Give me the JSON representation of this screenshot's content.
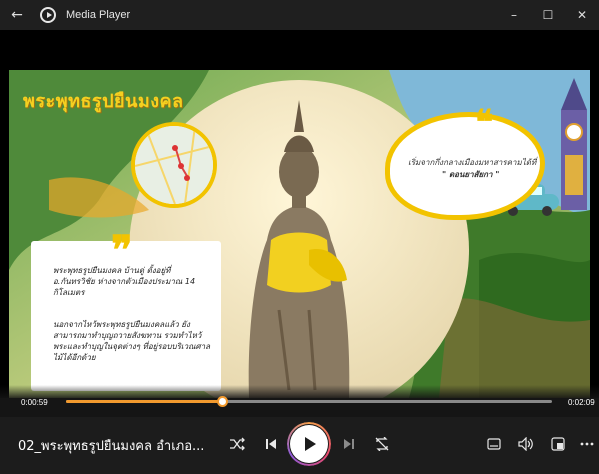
{
  "window": {
    "title": "Media Player",
    "controls": [
      "–",
      "☐",
      "✕"
    ]
  },
  "video": {
    "heading": "พระพุทธรูปยืนมงคล",
    "left_card": {
      "para1": "พระพุทธรูปยืนมงคล บ้านดู่ ตั้งอยู่ที่ อ.กันทรวิชัย ห่างจากตัวเมืองประมาณ 14 กิโลเมตร",
      "para2": "นอกจากไหว้พระพุทธรูปยืนมงคลแล้ว ยังสามารถมาทำบุญถวายสังฆทาน รวมทำไหว้พระและทำบุญในจุดต่างๆ ที่อยู่รอบบริเวณศาลไม้ได้อีกด้วย"
    },
    "right_card": {
      "line1": "เริ่มจากกึ่งกลางเมืองมหาสารคามได้ที่",
      "line2": "\" ดอนยาสัยกา \""
    }
  },
  "playback": {
    "current_time": "0:00:59",
    "total_time": "0:02:09",
    "progress": 0.32
  },
  "now_playing": {
    "title": "02_พระพุทธรูปยืนมงคล อำเภอ..."
  },
  "icons": {
    "back": "back-arrow-icon",
    "shuffle": "shuffle-icon",
    "previous": "previous-icon",
    "play": "play-icon",
    "next": "next-icon",
    "repeat": "repeat-icon",
    "subtitles": "subtitles-icon",
    "volume": "volume-icon",
    "miniplayer": "miniplayer-icon",
    "more": "more-icon"
  },
  "colors": {
    "accent": "#f29a2e",
    "titlebar": "#1f1f1f",
    "controls_bg": "#1c1c1c",
    "heading_yellow": "#f5d020"
  }
}
